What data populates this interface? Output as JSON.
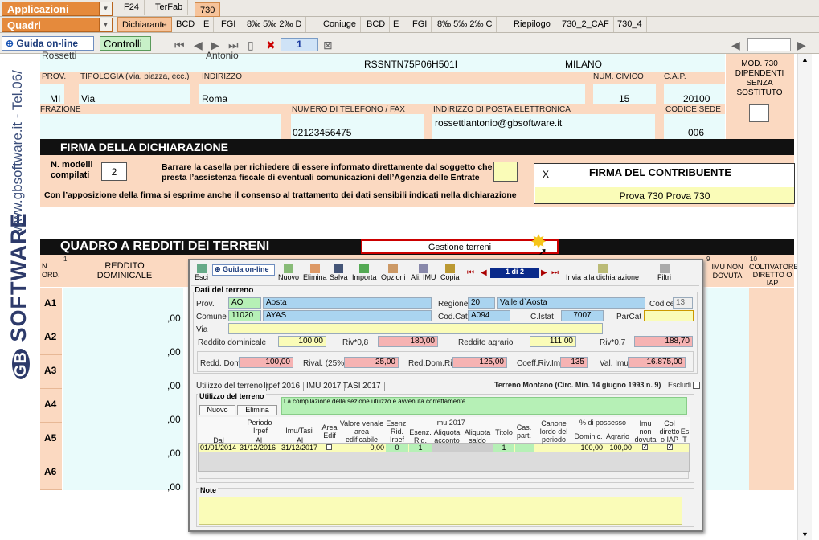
{
  "topbar": {
    "applicazioni": "Applicazioni",
    "quadri": "Quadri",
    "tabs": [
      "F24",
      "TerFab",
      "730"
    ],
    "subtabs": [
      "Dichiarante",
      "BCD",
      "E",
      "FGI",
      "8‰ 5‰ 2‰ D",
      "Coniuge",
      "BCD",
      "E",
      "FGI",
      "8‰ 5‰ 2‰ C",
      "Riepilogo",
      "730_2_CAF",
      "730_4"
    ]
  },
  "toolbar": {
    "guida": "Guida on-line",
    "controlli": "Controlli",
    "page": "1"
  },
  "side": {
    "brand": "SOFTWARE",
    "url": "www.gbsoftware.it - Tel.06/"
  },
  "header": {
    "name_top": "Rossetti",
    "firstname_top": "Antonio",
    "cf": "RSSNTN75P06H501I",
    "city_top": "MILANO",
    "prov_label": "PROV.",
    "prov": "MI",
    "tipologia_label": "TIPOLOGIA (Via, piazza, ecc.)",
    "tipologia": "Via",
    "indirizzo_label": "INDIRIZZO",
    "indirizzo": "Roma",
    "civico_label": "NUM. CIVICO",
    "civico": "15",
    "cap_label": "C.A.P.",
    "cap": "20100",
    "frazione_label": "FRAZIONE",
    "tel_label": "NUMERO DI TELEFONO / FAX",
    "tel": "02123456475",
    "email_label": "INDIRIZZO DI POSTA ELETTRONICA",
    "email": "rossettiantonio@gbsoftware.it",
    "sede_label": "CODICE SEDE",
    "sede": "006",
    "mod730": "MOD. 730 DIPENDENTI SENZA SOSTITUTO"
  },
  "firma": {
    "title": "FIRMA DELLA DICHIARAZIONE",
    "nmod_label": "N. modelli compilati",
    "nmod": "2",
    "barrare": "Barrare la casella per richiedere di essere informato direttamente dal soggetto che presta l’assistenza fiscale di eventuali comunicazioni dell’Agenzia delle Entrate",
    "consenso": "Con l’apposizione della firma si esprime anche il consenso al trattamento dei dati sensibili indicati nella dichiarazione",
    "x": "X",
    "contribuente_label": "FIRMA DEL CONTRIBUENTE",
    "contribuente": "Prova 730 Prova 730"
  },
  "quadro": {
    "title": "QUADRO  A  REDDITI DEI TERRENI",
    "gestione": "Gestione terreni",
    "col_nord": "N. ORD.",
    "col_reddito": "REDDITO DOMINICALE",
    "col_imu": "IMU NON DOVUTA",
    "col_colt": "COLTIVATORE DIRETTO O IAP",
    "col_num1": "1",
    "col_num9": "9",
    "col_num10": "10",
    "rows": [
      "A1",
      "A2",
      "A3",
      "A4",
      "A5",
      "A6"
    ],
    "zero": ",00"
  },
  "dialog": {
    "toolbar": [
      "Esci",
      "Guida on-line",
      "Nuovo",
      "Elimina",
      "Salva",
      "Importa",
      "Opzioni",
      "Ali. IMU",
      "Copia",
      "Invia alla dichiarazione",
      "Filtri"
    ],
    "pager": "1 di 2",
    "dati_title": "Dati del terreno",
    "prov_label": "Prov.",
    "prov_code": "AO",
    "prov_name": "Aosta",
    "regione_label": "Regione",
    "regione_code": "20",
    "regione_name": "Valle d`Aosta",
    "codice_label": "Codice",
    "codice": "13",
    "comune_label": "Comune",
    "comune_code": "11020",
    "comune_name": "AYAS",
    "codcat_label": "Cod.Cat.",
    "codcat": "A094",
    "cistat_label": "C.Istat",
    "cistat": "7007",
    "parcat_label": "ParCat",
    "via_label": "Via",
    "rd_label": "Reddito dominicale",
    "rd": "100,00",
    "riv08_label": "Riv*0,8",
    "riv08": "180,00",
    "ra_label": "Reddito agrario",
    "ra": "111,00",
    "riv07_label": "Riv*0,7",
    "riv07": "188,70",
    "reddom_label": "Redd. Dom.",
    "reddom": "100,00",
    "rival_label": "Rival. (25%)",
    "rival": "25,00",
    "reddomriv_label": "Red.Dom.Riv.",
    "reddomriv": "125,00",
    "coeff_label": "Coeff.Riv.Imu",
    "coeff": "135",
    "valimu_label": "Val. Imu",
    "valimu": "16.875,00",
    "subtabs": [
      "Utilizzo del terreno",
      "Irpef 2016",
      "IMU 2017",
      "TASI 2017"
    ],
    "montano": "Terreno Montano (Circ. Min. 14 giugno 1993 n. 9)",
    "escludi": "Escludi",
    "util_title": "Utilizzo del terreno",
    "nuovo": "Nuovo",
    "elimina": "Elimina",
    "msg": "La compilazione della sezione utilizzo è avvenuta correttamente",
    "grid": {
      "periodo": "Periodo",
      "irpef": "Irpef",
      "imutasi": "Imu/Tasi",
      "dal": "Dal",
      "al": "Al",
      "al2": "Al",
      "area": "Area Edif",
      "venale": "Valore venale area edificabile",
      "esenz": "Esenz. Rid. Irpef",
      "imu2017": "Imu 2017",
      "esenzrid": "Esenz. Rid.",
      "aliqacc": "Aliquota acconto",
      "aliqsal": "Aliquota saldo",
      "titolo": "Titolo",
      "cas": "Cas. part.",
      "canone": "Canone lordo del periodo",
      "possesso": "% di possesso",
      "domin": "Dominic.",
      "agrario": "Agrario",
      "imunon": "Imu non dovuta 2016",
      "coltiap": "Col diretto o IAP",
      "es": "Es T",
      "row": {
        "dal": "01/01/2014",
        "al_irpef": "31/12/2016",
        "al_imu": "31/12/2017",
        "venale": "0,00",
        "esenz": "0",
        "esenzrid": "1",
        "titolo": "1",
        "domin": "100,00",
        "agrario": "100,00"
      }
    },
    "note_title": "Note"
  }
}
